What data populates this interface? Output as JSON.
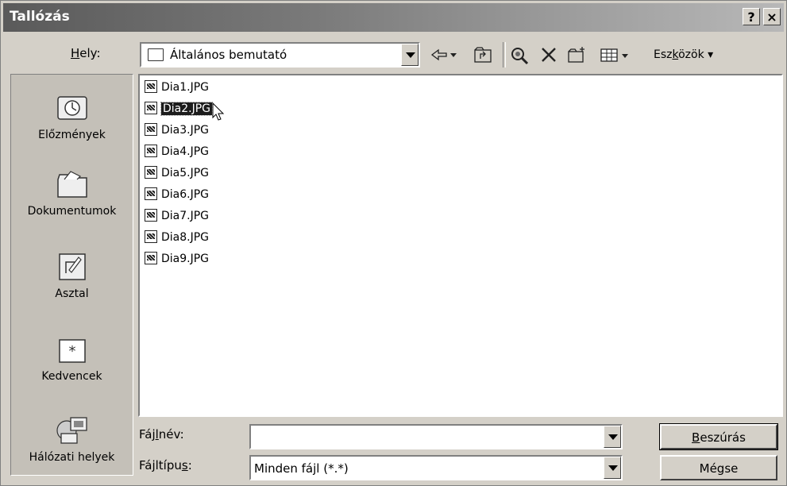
{
  "window": {
    "title": "Tallózás",
    "help_label": "?",
    "close_label": "×"
  },
  "lookin": {
    "label_pre": "",
    "label_u": "H",
    "label_post": "ely:",
    "value": "Általános bemutató"
  },
  "toolbar": {
    "tools_pre": "Esz",
    "tools_u": "k",
    "tools_post": "özök ▾"
  },
  "places": [
    {
      "label": "Előzmények",
      "icon": "history-icon"
    },
    {
      "label": "Dokumentumok",
      "icon": "documents-folder-icon"
    },
    {
      "label": "Asztal",
      "icon": "desktop-icon"
    },
    {
      "label": "Kedvencek",
      "icon": "favorites-icon"
    },
    {
      "label": "Hálózati helyek",
      "icon": "network-places-icon"
    }
  ],
  "files": [
    "Dia1.JPG",
    "Dia2.JPG",
    "Dia3.JPG",
    "Dia4.JPG",
    "Dia5.JPG",
    "Dia6.JPG",
    "Dia7.JPG",
    "Dia8.JPG",
    "Dia9.JPG"
  ],
  "selected_file": "Dia2.JPG",
  "filename": {
    "label_pre": "Fáj",
    "label_u": "l",
    "label_post": "név:",
    "value": ""
  },
  "filetype": {
    "label_pre": "Fájltípu",
    "label_u": "s",
    "label_post": ":",
    "value": "Minden fájl (*.*)"
  },
  "buttons": {
    "insert_u": "B",
    "insert_rest": "eszúrás",
    "cancel": "Mégse"
  }
}
